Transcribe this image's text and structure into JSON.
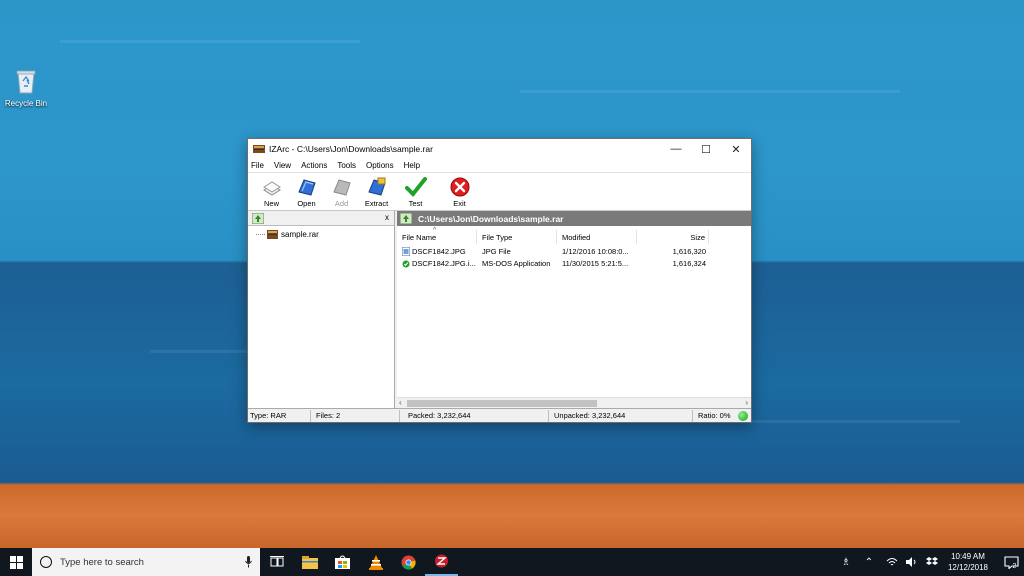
{
  "desktop": {
    "recycle_bin_label": "Recycle Bin"
  },
  "window": {
    "title": "IZArc - C:\\Users\\Jon\\Downloads\\sample.rar",
    "controls": {
      "minimize": "—",
      "maximize": "☐",
      "close": "✕"
    },
    "menu": [
      "File",
      "View",
      "Actions",
      "Tools",
      "Options",
      "Help"
    ],
    "toolbar": [
      {
        "label": "New",
        "icon": "new-archive-icon",
        "enabled": true
      },
      {
        "label": "Open",
        "icon": "open-archive-icon",
        "enabled": true
      },
      {
        "label": "Add",
        "icon": "add-files-icon",
        "enabled": false
      },
      {
        "label": "Extract",
        "icon": "extract-icon",
        "enabled": true
      },
      {
        "label": "Test",
        "icon": "checkmark-icon",
        "enabled": true
      },
      {
        "label": "Exit",
        "icon": "exit-icon",
        "enabled": true
      }
    ],
    "tree": {
      "close_label": "x",
      "items": [
        {
          "label": "sample.rar"
        }
      ]
    },
    "path": "C:\\Users\\Jon\\Downloads\\sample.rar",
    "columns": [
      "File Name",
      "File Type",
      "Modified",
      "Size"
    ],
    "files": [
      {
        "name": "DSCF1842.JPG",
        "type": "JPG File",
        "modified": "1/12/2016 10:08:0...",
        "size": "1,616,320",
        "icon": "image-file-icon"
      },
      {
        "name": "DSCF1842.JPG.i...",
        "type": "MS-DOS Application",
        "modified": "11/30/2015 5:21:5...",
        "size": "1,616,324",
        "icon": "executable-file-icon"
      }
    ],
    "status": {
      "type": "Type: RAR",
      "files": "Files: 2",
      "packed": "Packed: 3,232,644",
      "unpacked": "Unpacked: 3,232,644",
      "ratio": "Ratio: 0%"
    },
    "colors": {
      "path_bar": "#7a7a7a",
      "status_led": "#14a014"
    }
  },
  "taskbar": {
    "search_placeholder": "Type here to search",
    "apps": [
      "task-view-icon",
      "file-explorer-icon",
      "store-icon",
      "vlc-icon",
      "chrome-icon",
      "izarc-icon"
    ],
    "clock_time": "10:49 AM",
    "clock_date": "12/12/2018",
    "notification_count": "2"
  }
}
